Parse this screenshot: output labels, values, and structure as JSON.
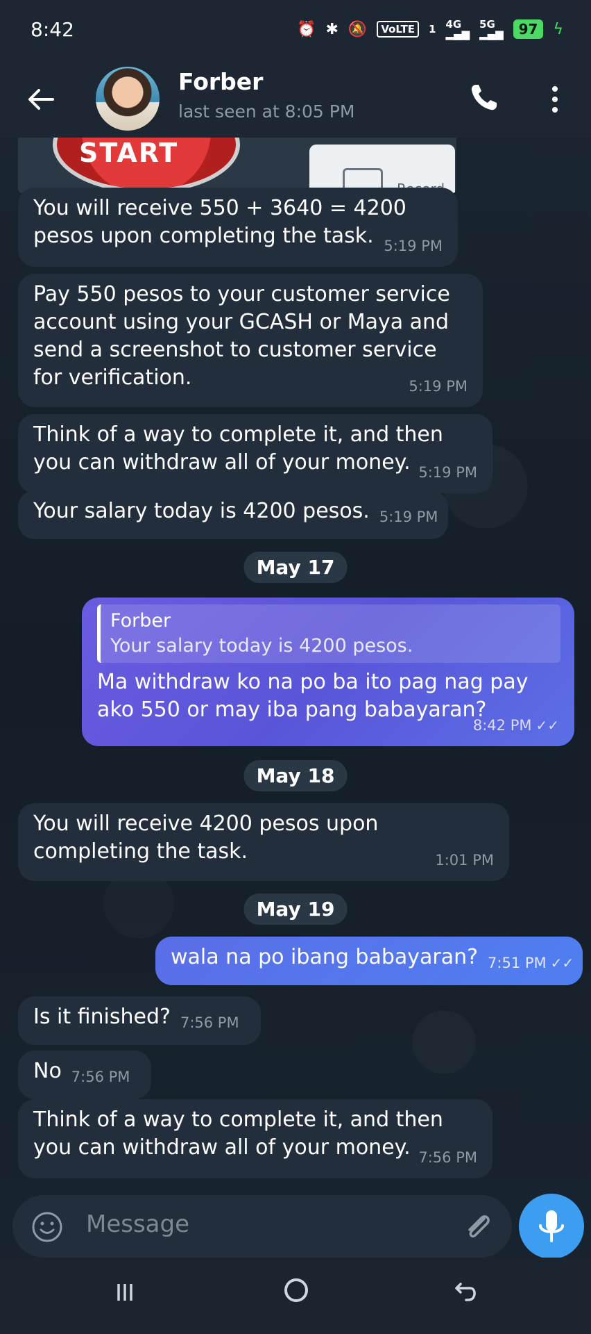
{
  "status_bar": {
    "time": "8:42",
    "volte": "VoLTE",
    "sim1": "1",
    "net1": "4G",
    "net2": "5G",
    "battery": "97"
  },
  "header": {
    "name": "Forber",
    "status": "last seen at 8:05 PM"
  },
  "image_message": {
    "start_label": "START",
    "record_label": "Record"
  },
  "messages": [
    {
      "direction": "in",
      "text": "You will receive 550 + 3640 = 4200 pesos upon completing the task.",
      "time": "5:19 PM"
    },
    {
      "direction": "in",
      "text": "Pay 550 pesos to your customer service account using your GCASH or Maya and send a screenshot to customer service for verification.",
      "time": "5:19 PM"
    },
    {
      "direction": "in",
      "text": "Think of a way to complete it, and then you can withdraw all of your money.",
      "time": "5:19 PM"
    },
    {
      "direction": "in",
      "text": "Your salary today is 4200 pesos.",
      "time": "5:19 PM"
    },
    {
      "date": "May 17"
    },
    {
      "direction": "out",
      "quote_name": "Forber",
      "quote_text": "Your salary today is 4200 pesos.",
      "text": "Ma withdraw ko na po ba ito pag nag pay ako 550 or may iba pang babayaran?",
      "time": "8:42 PM",
      "read": "✓✓"
    },
    {
      "date": "May 18"
    },
    {
      "direction": "in",
      "text": "You will receive 4200 pesos upon completing the task.",
      "time": "1:01 PM"
    },
    {
      "date": "May 19"
    },
    {
      "direction": "out",
      "text": "wala na po ibang babayaran?",
      "time": "7:51 PM",
      "read": "✓✓"
    },
    {
      "direction": "in",
      "text": "Is it finished?",
      "time": "7:56 PM"
    },
    {
      "direction": "in",
      "text": "No",
      "time": "7:56 PM"
    },
    {
      "direction": "in",
      "text": "Think of a way to complete it, and then you can withdraw all of your money.",
      "time": "7:56 PM"
    }
  ],
  "input": {
    "placeholder": "Message"
  },
  "icons": {
    "back": "arrow-left-icon",
    "call": "phone-icon",
    "menu": "more-vertical-icon",
    "emoji": "smiley-icon",
    "attach": "paperclip-icon",
    "mic": "microphone-icon"
  },
  "colors": {
    "outgoing_bubble": "#6a5ce0",
    "incoming_bubble": "#222e3b",
    "accent": "#3d9df0"
  }
}
